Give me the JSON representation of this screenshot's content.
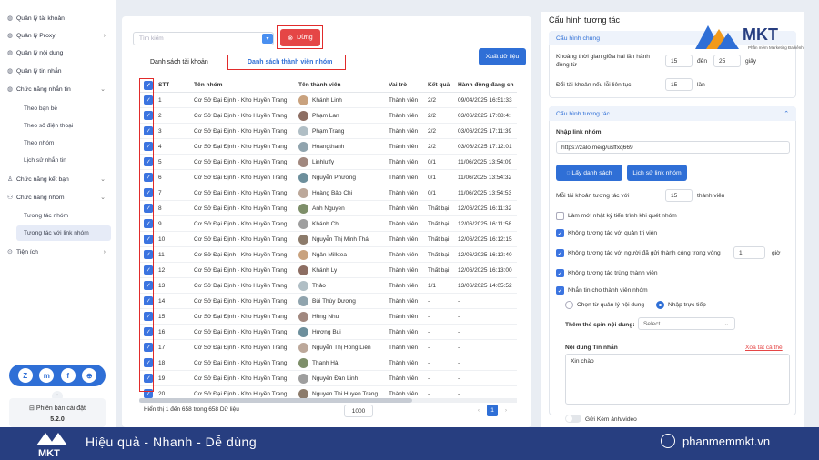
{
  "sidebar": {
    "items": [
      {
        "label": "Quản lý tài khoản",
        "icon": "user-icon",
        "chevron": false
      },
      {
        "label": "Quản lý Proxy",
        "icon": "proxy-icon",
        "chevron": true
      },
      {
        "label": "Quản lý nội dung",
        "icon": "content-icon",
        "chevron": false
      },
      {
        "label": "Quản lý tin nhắn",
        "icon": "message-icon",
        "chevron": false
      },
      {
        "label": "Chức năng nhắn tin",
        "icon": "chat-icon",
        "chevron": true
      }
    ],
    "sub_messaging": [
      "Theo bạn bè",
      "Theo số điện thoại",
      "Theo nhóm",
      "Lịch sử nhắn tin"
    ],
    "item_friends": "Chức năng kết bạn",
    "item_groups": "Chức năng nhóm",
    "sub_groups": [
      "Tương tác nhóm",
      "Tương tác với link nhóm"
    ],
    "item_utils": "Tiện ích",
    "version_label": "Phiên bản cài đặt",
    "version": "5.2.0"
  },
  "toolbar": {
    "search_placeholder": "Tìm kiếm",
    "stop_label": "Dừng",
    "export_label": "Xuất dữ liệu",
    "tab_accounts": "Danh sách tài khoản",
    "tab_members": "Danh sách thành viên nhóm"
  },
  "table": {
    "headers": [
      "STT",
      "Tên nhóm",
      "Tên thành viên",
      "Vai trò",
      "Kết quả",
      "Hành động đang ch"
    ],
    "rows": [
      [
        "1",
        "Cơ Sở Đại Định - Kho Huyền Trang",
        "Khánh Linh",
        "Thành viên",
        "2/2",
        "09/04/2025 16:51:33"
      ],
      [
        "2",
        "Cơ Sở Đại Định - Kho Huyền Trang",
        "Phạm Lan",
        "Thành viên",
        "2/2",
        "03/06/2025 17:08:4:"
      ],
      [
        "3",
        "Cơ Sở Đại Định - Kho Huyền Trang",
        "Phạm Trang",
        "Thành viên",
        "2/2",
        "03/06/2025 17:11:39"
      ],
      [
        "4",
        "Cơ Sở Đại Định - Kho Huyền Trang",
        "Hoangthanh",
        "Thành viên",
        "2/2",
        "03/06/2025 17:12:01"
      ],
      [
        "5",
        "Cơ Sở Đại Định - Kho Huyền Trang",
        "Linhluffy",
        "Thành viên",
        "0/1",
        "11/06/2025 13:54:09"
      ],
      [
        "6",
        "Cơ Sở Đại Định - Kho Huyền Trang",
        "Nguyễn Phương",
        "Thành viên",
        "0/1",
        "11/06/2025 13:54:32"
      ],
      [
        "7",
        "Cơ Sở Đại Định - Kho Huyền Trang",
        "Hoàng Bảo Chi",
        "Thành viên",
        "0/1",
        "11/06/2025 13:54:53"
      ],
      [
        "8",
        "Cơ Sở Đại Định - Kho Huyền Trang",
        "Anh Nguyen",
        "Thành viên",
        "Thất bại",
        "12/06/2025 16:11:32"
      ],
      [
        "9",
        "Cơ Sở Đại Định - Kho Huyền Trang",
        "Khánh Chi",
        "Thành viên",
        "Thất bại",
        "12/06/2025 16:11:58"
      ],
      [
        "10",
        "Cơ Sở Đại Định - Kho Huyền Trang",
        "Nguyễn Thị Minh Thái",
        "Thành viên",
        "Thất bại",
        "12/06/2025 16:12:15"
      ],
      [
        "11",
        "Cơ Sở Đại Định - Kho Huyền Trang",
        "Ngân Milktea",
        "Thành viên",
        "Thất bại",
        "12/06/2025 16:12:40"
      ],
      [
        "12",
        "Cơ Sở Đại Định - Kho Huyền Trang",
        "Khánh Ly",
        "Thành viên",
        "Thất bại",
        "12/06/2025 16:13:00"
      ],
      [
        "13",
        "Cơ Sở Đại Định - Kho Huyền Trang",
        "Thảo",
        "Thành viên",
        "1/1",
        "13/06/2025 14:05:52"
      ],
      [
        "14",
        "Cơ Sở Đại Định - Kho Huyền Trang",
        "Bùi Thùy Dương",
        "Thành viên",
        "-",
        "-"
      ],
      [
        "15",
        "Cơ Sở Đại Định - Kho Huyền Trang",
        "Hồng Như",
        "Thành viên",
        "-",
        "-"
      ],
      [
        "16",
        "Cơ Sở Đại Định - Kho Huyền Trang",
        "Hương Bui",
        "Thành viên",
        "-",
        "-"
      ],
      [
        "17",
        "Cơ Sở Đại Định - Kho Huyền Trang",
        "Nguyễn Thị Hồng Liên",
        "Thành viên",
        "-",
        "-"
      ],
      [
        "18",
        "Cơ Sở Đại Định - Kho Huyền Trang",
        "Thanh Hà",
        "Thành viên",
        "-",
        "-"
      ],
      [
        "19",
        "Cơ Sở Đại Định - Kho Huyền Trang",
        "Nguyễn Đan Linh",
        "Thành viên",
        "-",
        "-"
      ],
      [
        "20",
        "Cơ Sở Đại Định - Kho Huyền Trang",
        "Nguyen Thi Huyen Trang",
        "Thành viên",
        "-",
        "-"
      ]
    ],
    "footer_info": "Hiển thị 1 đến 658 trong 658 Dữ liệu",
    "page_size": "1000",
    "current_page": "1"
  },
  "right": {
    "title": "Cấu hình tương tác",
    "general_header": "Cấu hình chung",
    "delay_label": "Khoảng thời gian giữa hai lần hành động từ",
    "delay_from": "15",
    "delay_to_label": "đến",
    "delay_to": "25",
    "delay_unit": "giây",
    "switch_label": "Đổi tài khoản nếu lỗi liên tục",
    "switch_value": "15",
    "switch_unit": "lần",
    "interact_header": "Cấu hình tương tác",
    "link_label": "Nhập link nhóm",
    "link_value": "https://zalo.me/g/usffxq669",
    "get_list_label": "Lấy danh sách",
    "history_label": "Lịch sử link nhóm",
    "per_account_label": "Mỗi tài khoản tương tác với",
    "per_account_value": "15",
    "per_account_unit": "thành viên",
    "options": [
      {
        "label": "Làm mới nhật ký tiến trình khi quét nhóm",
        "checked": false
      },
      {
        "label": "Không tương tác với quản trị viên",
        "checked": true
      },
      {
        "label": "Không tương tác với người đã gửi thành công trong vòng",
        "checked": true
      },
      {
        "label": "Không tương tác trùng thành viên",
        "checked": true
      },
      {
        "label": "Nhắn tin cho thành viên nhóm",
        "checked": true
      }
    ],
    "within_value": "1",
    "within_unit": "giờ",
    "radio_manage": "Chọn từ quản lý nội dung",
    "radio_direct": "Nhập trực tiếp",
    "spin_label": "Thêm thẻ spin nội dung:",
    "spin_select": "Select...",
    "content_label": "Nội dung Tin nhắn",
    "clear_all": "Xóa tất cả thẻ",
    "message": "Xin chào",
    "attach_label": "Gửi Kèm ảnh/video"
  },
  "brand": {
    "logo_text": "MKT",
    "logo_tagline": "Phần mềm Marketing Đa kênh",
    "slogan": "Hiệu quả - Nhanh - Dễ dùng",
    "site": "phanmemmkt.vn"
  },
  "colors": {
    "accent": "#2f6fd6",
    "stop": "#e54646",
    "bottom_bar": "#273e80",
    "highlight": "#e12b2b"
  }
}
